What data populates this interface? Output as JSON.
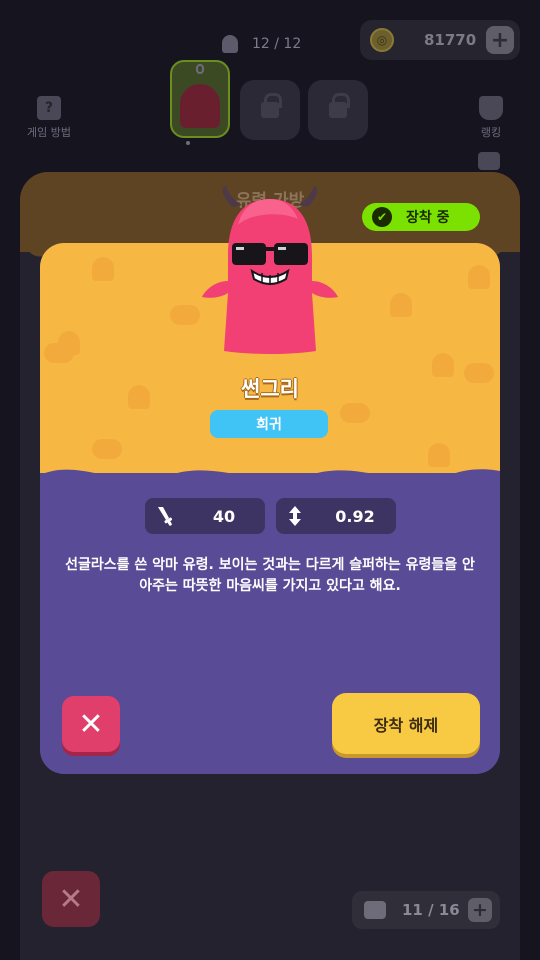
{
  "top_bar": {
    "ghost_count": "12 / 12",
    "coins": "81770",
    "coin_plus": "+"
  },
  "left_menu": {
    "how_to_play": "게임 방법",
    "help_glyph": "?"
  },
  "right_menu": {
    "ranking": "랭킹"
  },
  "bag": {
    "title": "유령 가방",
    "equipped_badge": "장착 중",
    "capacity": "11 / 16",
    "capacity_plus": "+"
  },
  "detail": {
    "name": "썬그리",
    "rarity": "희귀",
    "stats": [
      {
        "icon": "sword-icon",
        "value": "40"
      },
      {
        "icon": "range-arrow-icon",
        "value": "0.92"
      }
    ],
    "description": "선글라스를 쓴 악마 유령. 보이는 것과는 다르게 슬퍼하는 유령들을 안아주는 따뜻한 마음씨를 가지고 있다고 해요.",
    "close_glyph": "✕",
    "unequip_label": "장착 해제"
  },
  "colors": {
    "card_top": "#f7b843",
    "card_bottom": "#5a4b96",
    "rarity": "#40c3f5",
    "equipped": "#7be100",
    "close": "#e03e6b",
    "unequip": "#f8c942",
    "ghost_body": "#f23f74"
  }
}
